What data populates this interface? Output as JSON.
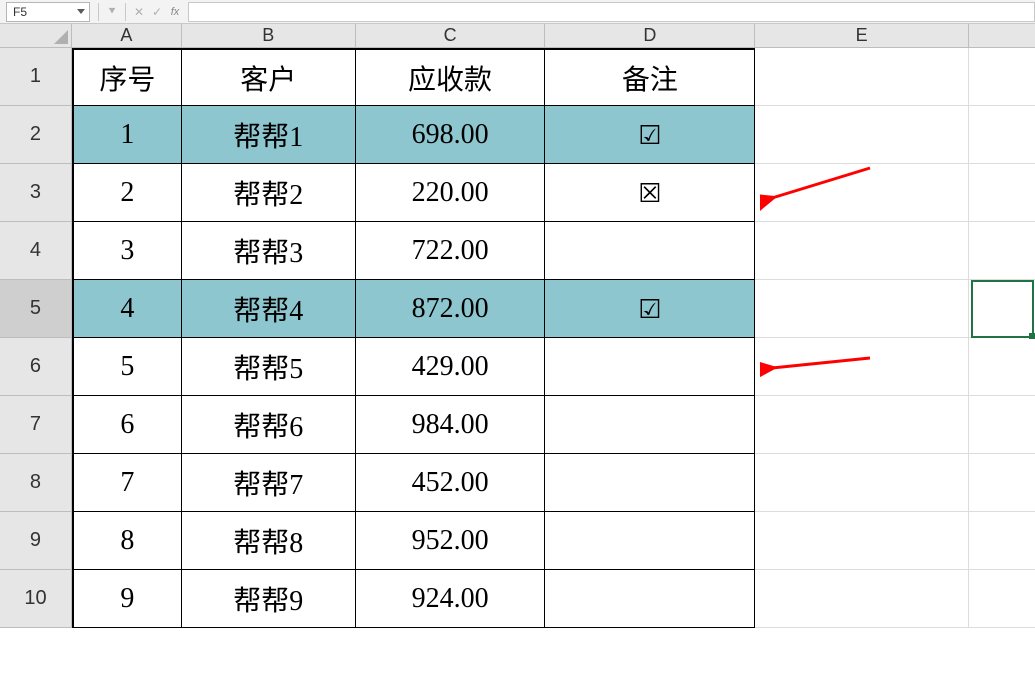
{
  "formula_bar": {
    "cell_ref": "F5",
    "formula": ""
  },
  "columns": [
    "A",
    "B",
    "C",
    "D",
    "E"
  ],
  "row_numbers": [
    "1",
    "2",
    "3",
    "4",
    "5",
    "6",
    "7",
    "8",
    "9",
    "10"
  ],
  "active_row_header": "5",
  "headers": {
    "seq": "序号",
    "customer": "客户",
    "receivable": "应收款",
    "note": "备注"
  },
  "rows": [
    {
      "seq": "1",
      "customer": "帮帮1",
      "receivable": "698.00",
      "note": "check",
      "highlight": true
    },
    {
      "seq": "2",
      "customer": "帮帮2",
      "receivable": "220.00",
      "note": "cross",
      "highlight": false
    },
    {
      "seq": "3",
      "customer": "帮帮3",
      "receivable": "722.00",
      "note": "",
      "highlight": false
    },
    {
      "seq": "4",
      "customer": "帮帮4",
      "receivable": "872.00",
      "note": "check",
      "highlight": true
    },
    {
      "seq": "5",
      "customer": "帮帮5",
      "receivable": "429.00",
      "note": "",
      "highlight": false
    },
    {
      "seq": "6",
      "customer": "帮帮6",
      "receivable": "984.00",
      "note": "",
      "highlight": false
    },
    {
      "seq": "7",
      "customer": "帮帮7",
      "receivable": "452.00",
      "note": "",
      "highlight": false
    },
    {
      "seq": "8",
      "customer": "帮帮8",
      "receivable": "952.00",
      "note": "",
      "highlight": false
    },
    {
      "seq": "9",
      "customer": "帮帮9",
      "receivable": "924.00",
      "note": "",
      "highlight": false
    }
  ],
  "marks": {
    "check": "☑",
    "cross": "☒"
  },
  "colors": {
    "highlight": "#8dc6cf",
    "header_bg": "#e6e6e6",
    "selection_green": "#217346",
    "arrow_red": "#ff0000"
  }
}
